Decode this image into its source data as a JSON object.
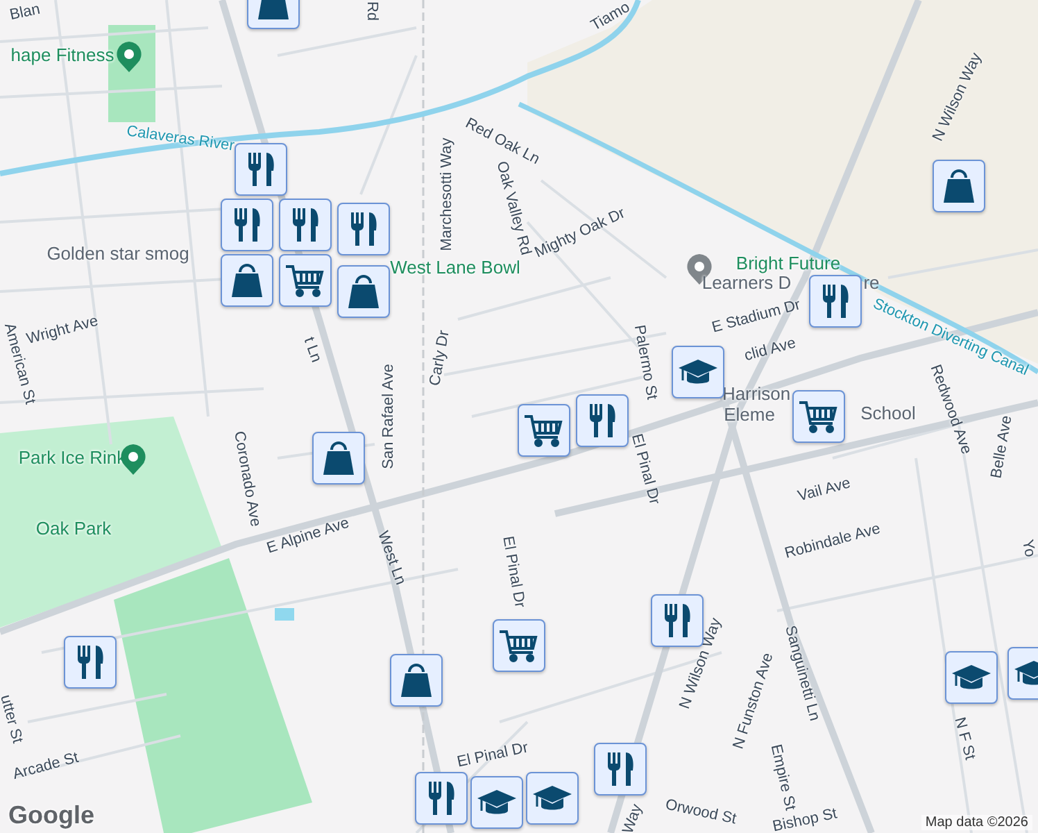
{
  "labels": [
    {
      "text": "Blan",
      "kind": "street"
    },
    {
      "text": "hape Fitness",
      "kind": "poi",
      "color": "#1e8e5e"
    },
    {
      "text": "Rd",
      "kind": "street"
    },
    {
      "text": "Tiamo",
      "kind": "street"
    },
    {
      "text": "Calaveras River",
      "kind": "water"
    },
    {
      "text": "Red Oak Ln",
      "kind": "street"
    },
    {
      "text": "Marchesotti Way",
      "kind": "street"
    },
    {
      "text": "Oak Valley Rd",
      "kind": "street"
    },
    {
      "text": "Mighty Oak Dr",
      "kind": "street"
    },
    {
      "text": "Golden star smog",
      "kind": "place"
    },
    {
      "text": "West Lane Bowl",
      "kind": "park"
    },
    {
      "text": "Bright Future",
      "kind": "poi",
      "color": "#80868b"
    },
    {
      "text": "Learners D",
      "kind": "place"
    },
    {
      "text": "re",
      "kind": "place"
    },
    {
      "text": "E Stadium Dr",
      "kind": "street"
    },
    {
      "text": "clid Ave",
      "kind": "street"
    },
    {
      "text": "Palermo St",
      "kind": "street"
    },
    {
      "text": "Harrison",
      "kind": "place"
    },
    {
      "text": "Eleme",
      "kind": "place"
    },
    {
      "text": "School",
      "kind": "place"
    },
    {
      "text": "Stockton Diverting Canal",
      "kind": "water"
    },
    {
      "text": "N Wilson Way",
      "kind": "street"
    },
    {
      "text": "Redwood Ave",
      "kind": "street"
    },
    {
      "text": "Belle Ave",
      "kind": "street"
    },
    {
      "text": "Yo",
      "kind": "street"
    },
    {
      "text": "American St",
      "kind": "street"
    },
    {
      "text": "Wright Ave",
      "kind": "street"
    },
    {
      "text": "t Ln",
      "kind": "street"
    },
    {
      "text": "Carly Dr",
      "kind": "street"
    },
    {
      "text": "San Rafael Ave",
      "kind": "street"
    },
    {
      "text": "Coronado Ave",
      "kind": "street"
    },
    {
      "text": "Park Ice Rink",
      "kind": "poi",
      "color": "#1e8e5e"
    },
    {
      "text": "Oak Park",
      "kind": "park"
    },
    {
      "text": "E Alpine Ave",
      "kind": "street"
    },
    {
      "text": "West Ln",
      "kind": "street"
    },
    {
      "text": "El Pinal Dr",
      "kind": "street"
    },
    {
      "text": "El Pinal Dr",
      "kind": "street"
    },
    {
      "text": "El Pinal Dr",
      "kind": "street"
    },
    {
      "text": "Vail Ave",
      "kind": "street"
    },
    {
      "text": "Robindale Ave",
      "kind": "street"
    },
    {
      "text": "N Wilson Way",
      "kind": "street"
    },
    {
      "text": "N Funston Ave",
      "kind": "street"
    },
    {
      "text": "Sanguinetti Ln",
      "kind": "street"
    },
    {
      "text": "Empire St",
      "kind": "street"
    },
    {
      "text": "N F St",
      "kind": "street"
    },
    {
      "text": "Orwood St",
      "kind": "street"
    },
    {
      "text": "Bishop St",
      "kind": "street"
    },
    {
      "text": "Arcade St",
      "kind": "street"
    },
    {
      "text": "utter St",
      "kind": "street"
    },
    {
      "text": "Way",
      "kind": "street"
    }
  ],
  "markers": [
    {
      "kind": "shopping"
    },
    {
      "kind": "restaurant"
    },
    {
      "kind": "restaurant"
    },
    {
      "kind": "restaurant"
    },
    {
      "kind": "restaurant"
    },
    {
      "kind": "shopping"
    },
    {
      "kind": "cart"
    },
    {
      "kind": "shopping"
    },
    {
      "kind": "shopping"
    },
    {
      "kind": "restaurant"
    },
    {
      "kind": "school"
    },
    {
      "kind": "cart"
    },
    {
      "kind": "restaurant"
    },
    {
      "kind": "cart"
    },
    {
      "kind": "shopping"
    },
    {
      "kind": "restaurant"
    },
    {
      "kind": "restaurant"
    },
    {
      "kind": "cart"
    },
    {
      "kind": "shopping"
    },
    {
      "kind": "restaurant"
    },
    {
      "kind": "restaurant"
    },
    {
      "kind": "school"
    },
    {
      "kind": "school"
    },
    {
      "kind": "school"
    },
    {
      "kind": "school"
    }
  ],
  "attribution": "Map data ©2026",
  "logo": "Google"
}
